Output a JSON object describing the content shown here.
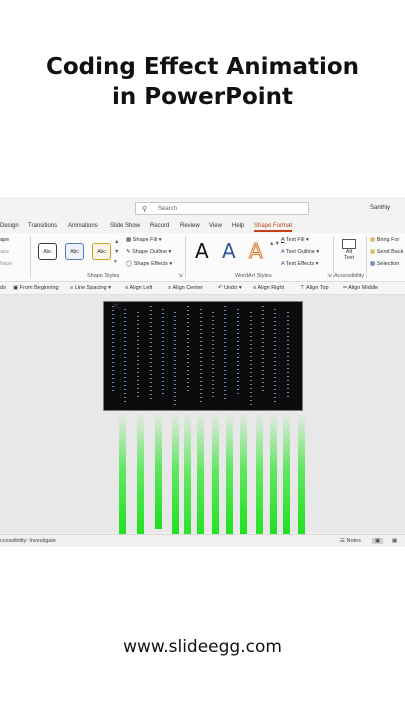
{
  "header": {
    "title_line1": "Coding Effect Animation",
    "title_line2": "in PowerPoint"
  },
  "footer": {
    "website": "www.slideegg.com"
  },
  "window": {
    "search_placeholder": "Search",
    "user_name": "Santhiy"
  },
  "tabs": [
    {
      "label": "Design"
    },
    {
      "label": "Transitions"
    },
    {
      "label": "Animations"
    },
    {
      "label": "Slide Show"
    },
    {
      "label": "Record"
    },
    {
      "label": "Review"
    },
    {
      "label": "View"
    },
    {
      "label": "Help"
    },
    {
      "label": "Shape Format",
      "active": true
    }
  ],
  "ribbon": {
    "left_fragments": [
      "ape",
      "ape",
      "hape"
    ],
    "shape_styles": {
      "thumb_label": "Abc",
      "fill": "Shape Fill",
      "outline": "Shape Outline",
      "effects": "Shape Effects",
      "group_label": "Shape Styles"
    },
    "wordart": {
      "letter": "A",
      "text_fill": "Text Fill",
      "text_outline": "Text Outline",
      "text_effects": "Text Effects",
      "group_label": "WordArt Styles"
    },
    "alt_text": {
      "line1": "Alt",
      "line2": "Text"
    },
    "accessibility_label": "Accessibility",
    "arrange": {
      "bring_forward": "Bring For",
      "send_backward": "Send Back",
      "selection": "Selection"
    }
  },
  "quick_access": [
    "do",
    "From Beginning",
    "Line Spacing",
    "Align Left",
    "Align Center",
    "Undo",
    "Align Right",
    "Align Top",
    "Align Middle"
  ],
  "status_bar": {
    "accessibility": "ccessibility: Investigate",
    "notes": "Notes"
  },
  "colors": {
    "accent": "#c43e1c",
    "matrix_blue": "#6fa3e0",
    "matrix_green": "#1ee01e",
    "slide_bg": "#0b0b0b"
  }
}
